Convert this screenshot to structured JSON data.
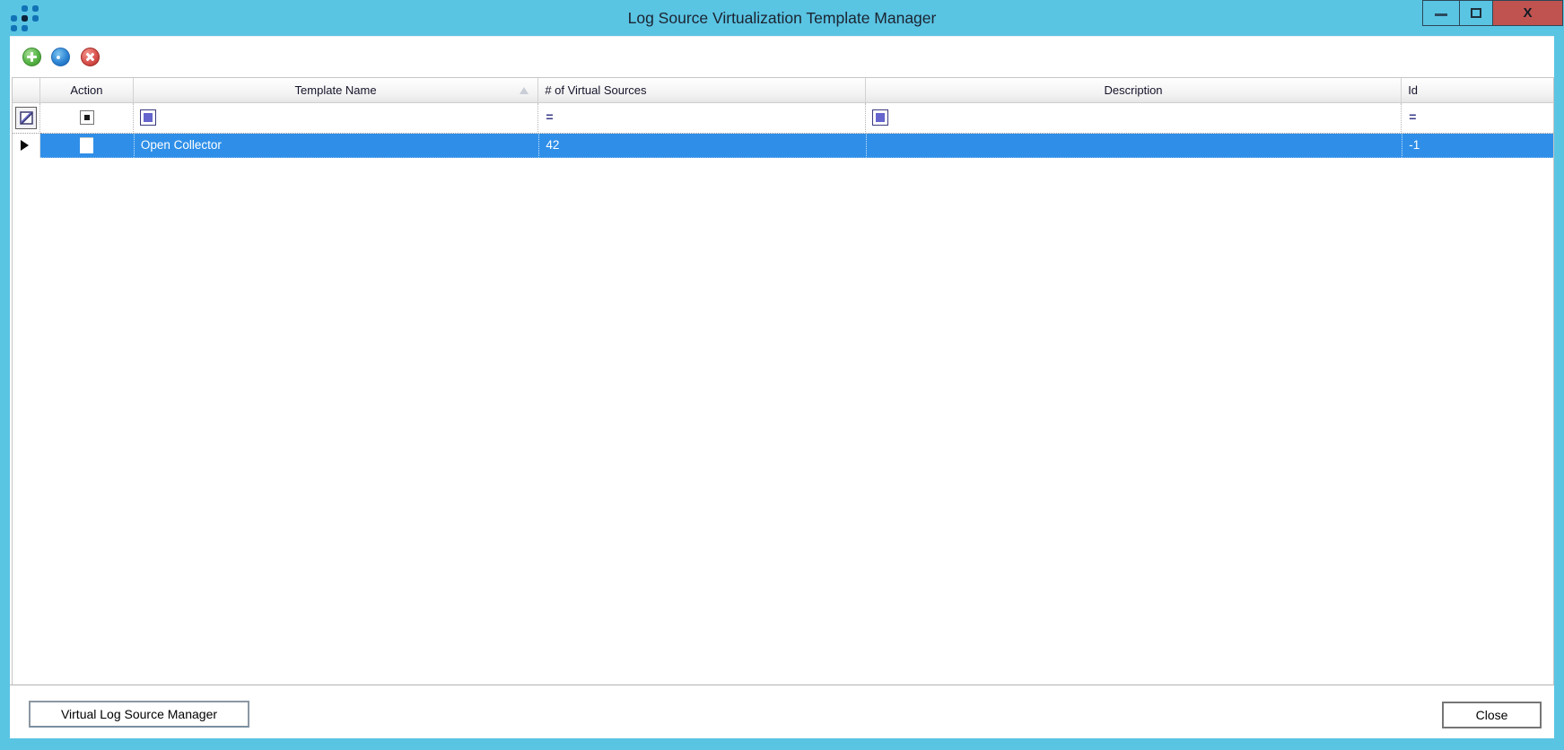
{
  "window": {
    "title": "Log Source Virtualization Template Manager",
    "controls": {
      "minimize": "minimize-icon",
      "maximize": "maximize-icon",
      "close_glyph": "X"
    }
  },
  "toolbar": {
    "buttons": [
      {
        "name": "add",
        "icon": "add-plus-icon",
        "color": "#57B546"
      },
      {
        "name": "properties",
        "icon": "properties-icon",
        "color": "#2E86D4"
      },
      {
        "name": "delete",
        "icon": "delete-x-icon",
        "color": "#D9534F"
      }
    ]
  },
  "grid": {
    "filter_equals": "=",
    "columns": [
      {
        "label": "",
        "name": "row-selector"
      },
      {
        "label": "Action",
        "filter": "checkbox-indeterminate"
      },
      {
        "label": "Template Name",
        "sort": "ascending",
        "filter": "blue-square"
      },
      {
        "label": "# of Virtual Sources",
        "filter": "equals"
      },
      {
        "label": "Description",
        "filter": "blue-square"
      },
      {
        "label": "Id",
        "filter": "equals"
      }
    ],
    "rows": [
      {
        "selected": true,
        "action_checked": false,
        "template_name": "Open Collector",
        "virtual_sources": "42",
        "description": "",
        "id": "-1"
      }
    ]
  },
  "footer": {
    "virtual_log_source_manager": "Virtual Log Source Manager",
    "close": "Close"
  },
  "colors": {
    "titlebar": "#5AC4E3",
    "selection": "#2F8FE8",
    "close_button_red": "#C0534F"
  }
}
